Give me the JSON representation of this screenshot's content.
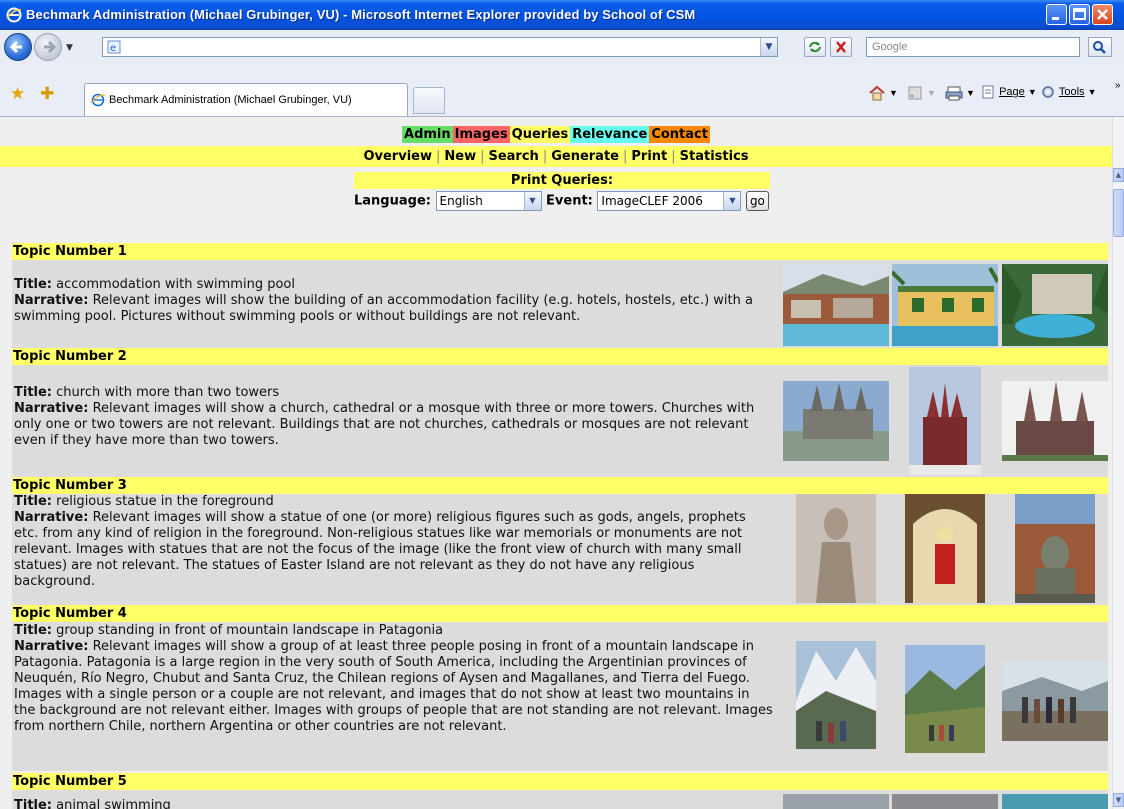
{
  "window": {
    "title": "Bechmark Administration (Michael Grubinger, VU) - Microsoft Internet Explorer provided by School of CSM"
  },
  "address_bar": {
    "url": "",
    "search_placeholder": "Google"
  },
  "tab": {
    "label": "Bechmark Administration (Michael Grubinger, VU)"
  },
  "command_bar": {
    "page_label": "Page",
    "tools_label": "Tools"
  },
  "menu": {
    "items": [
      {
        "label": "Admin",
        "color": "#66dd66"
      },
      {
        "label": "Images",
        "color": "#ff6666"
      },
      {
        "label": "Queries",
        "color": "#ffff66"
      },
      {
        "label": "Relevance",
        "color": "#66ffee"
      },
      {
        "label": "Contact",
        "color": "#ff8800"
      }
    ]
  },
  "subnav": {
    "items": [
      "Overview",
      "New",
      "Search",
      "Generate",
      "Print",
      "Statistics"
    ]
  },
  "print_form": {
    "heading": "Print Queries:",
    "language_label": "Language:",
    "language_value": "English",
    "event_label": "Event:",
    "event_value": "ImageCLEF 2006",
    "go_label": "go"
  },
  "topics": [
    {
      "header": "Topic Number 1",
      "title_label": "Title:",
      "title": "accommodation with swimming pool",
      "narrative_label": "Narrative:",
      "narrative": "Relevant images will show the building of an accommodation facility (e.g. hotels, hostels, etc.) with a swimming pool. Pictures without swimming pools or without buildings are not relevant."
    },
    {
      "header": "Topic Number 2",
      "title_label": "Title:",
      "title": "church with more than two towers",
      "narrative_label": "Narrative:",
      "narrative": "Relevant images will show a church, cathedral or a mosque with three or more towers. Churches with only one or two towers are not relevant. Buildings that are not churches, cathedrals or mosques are not relevant even if they have more than two towers."
    },
    {
      "header": "Topic Number 3",
      "title_label": "Title:",
      "title": "religious statue in the foreground",
      "narrative_label": "Narrative:",
      "narrative": "Relevant images will show a statue of one (or more) religious figures such as gods, angels, prophets etc. from any kind of religion in the foreground. Non-religious statues like war memorials or monuments are not relevant. Images with statues that are not the focus of the image (like the front view of church with many small statues) are not relevant. The statues of Easter Island are not relevant as they do not have any religious background."
    },
    {
      "header": "Topic Number 4",
      "title_label": "Title:",
      "title": "group standing in front of mountain landscape in Patagonia",
      "narrative_label": "Narrative:",
      "narrative": "Relevant images will show a group of at least three people posing in front of a mountain landscape in Patagonia. Patagonia is a large region in the very south of South America, including the Argentinian provinces of Neuquén, Río Negro, Chubut and Santa Cruz, the Chilean regions of Aysen and Magallanes, and Tierra del Fuego. Images with a single person or a couple are not relevant, and images that do not show at least two mountains in the background are not relevant either. Images with groups of people that are not standing are not relevant. Images from northern Chile, northern Argentina or other countries are not relevant."
    },
    {
      "header": "Topic Number 5",
      "title_label": "Title:",
      "title": "animal swimming"
    }
  ]
}
